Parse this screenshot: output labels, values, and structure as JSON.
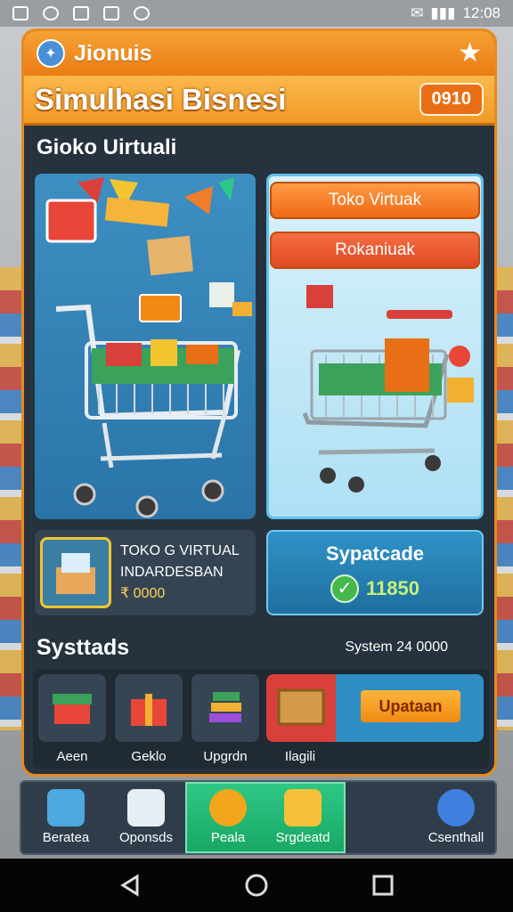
{
  "status_bar": {
    "time": "12:08"
  },
  "header": {
    "brand": "Jionuis",
    "title": "Simulhasi Bisnesi",
    "badge": "0910"
  },
  "store_section": {
    "title": "Gioko Uirtuali"
  },
  "hero": {
    "btn_primary": "Toko Virtuak",
    "btn_secondary": "Rokaniuak"
  },
  "info_card": {
    "line1": "TOKO G VIRTUAL",
    "line2": "INDARDESBAN",
    "price": "0000"
  },
  "upgrade_card": {
    "title": "Sypatcade",
    "value": "11850"
  },
  "system_row": {
    "label": "Systtads",
    "stat": "System 24 0000"
  },
  "tiles": [
    {
      "label": "Aeen"
    },
    {
      "label": "Geklo"
    },
    {
      "label": "Upgrdn"
    },
    {
      "label": "Ilagili"
    }
  ],
  "upgrade_cta": "Upataan",
  "bottom_nav": [
    {
      "label": "Beratea"
    },
    {
      "label": "Oponsds"
    },
    {
      "label": "Peala"
    },
    {
      "label": "Srgdeatd"
    },
    {
      "label": "Csenthall"
    }
  ],
  "colors": {
    "accent": "#f29a26",
    "panel": "#26323d",
    "active_tab": "#18a865"
  }
}
